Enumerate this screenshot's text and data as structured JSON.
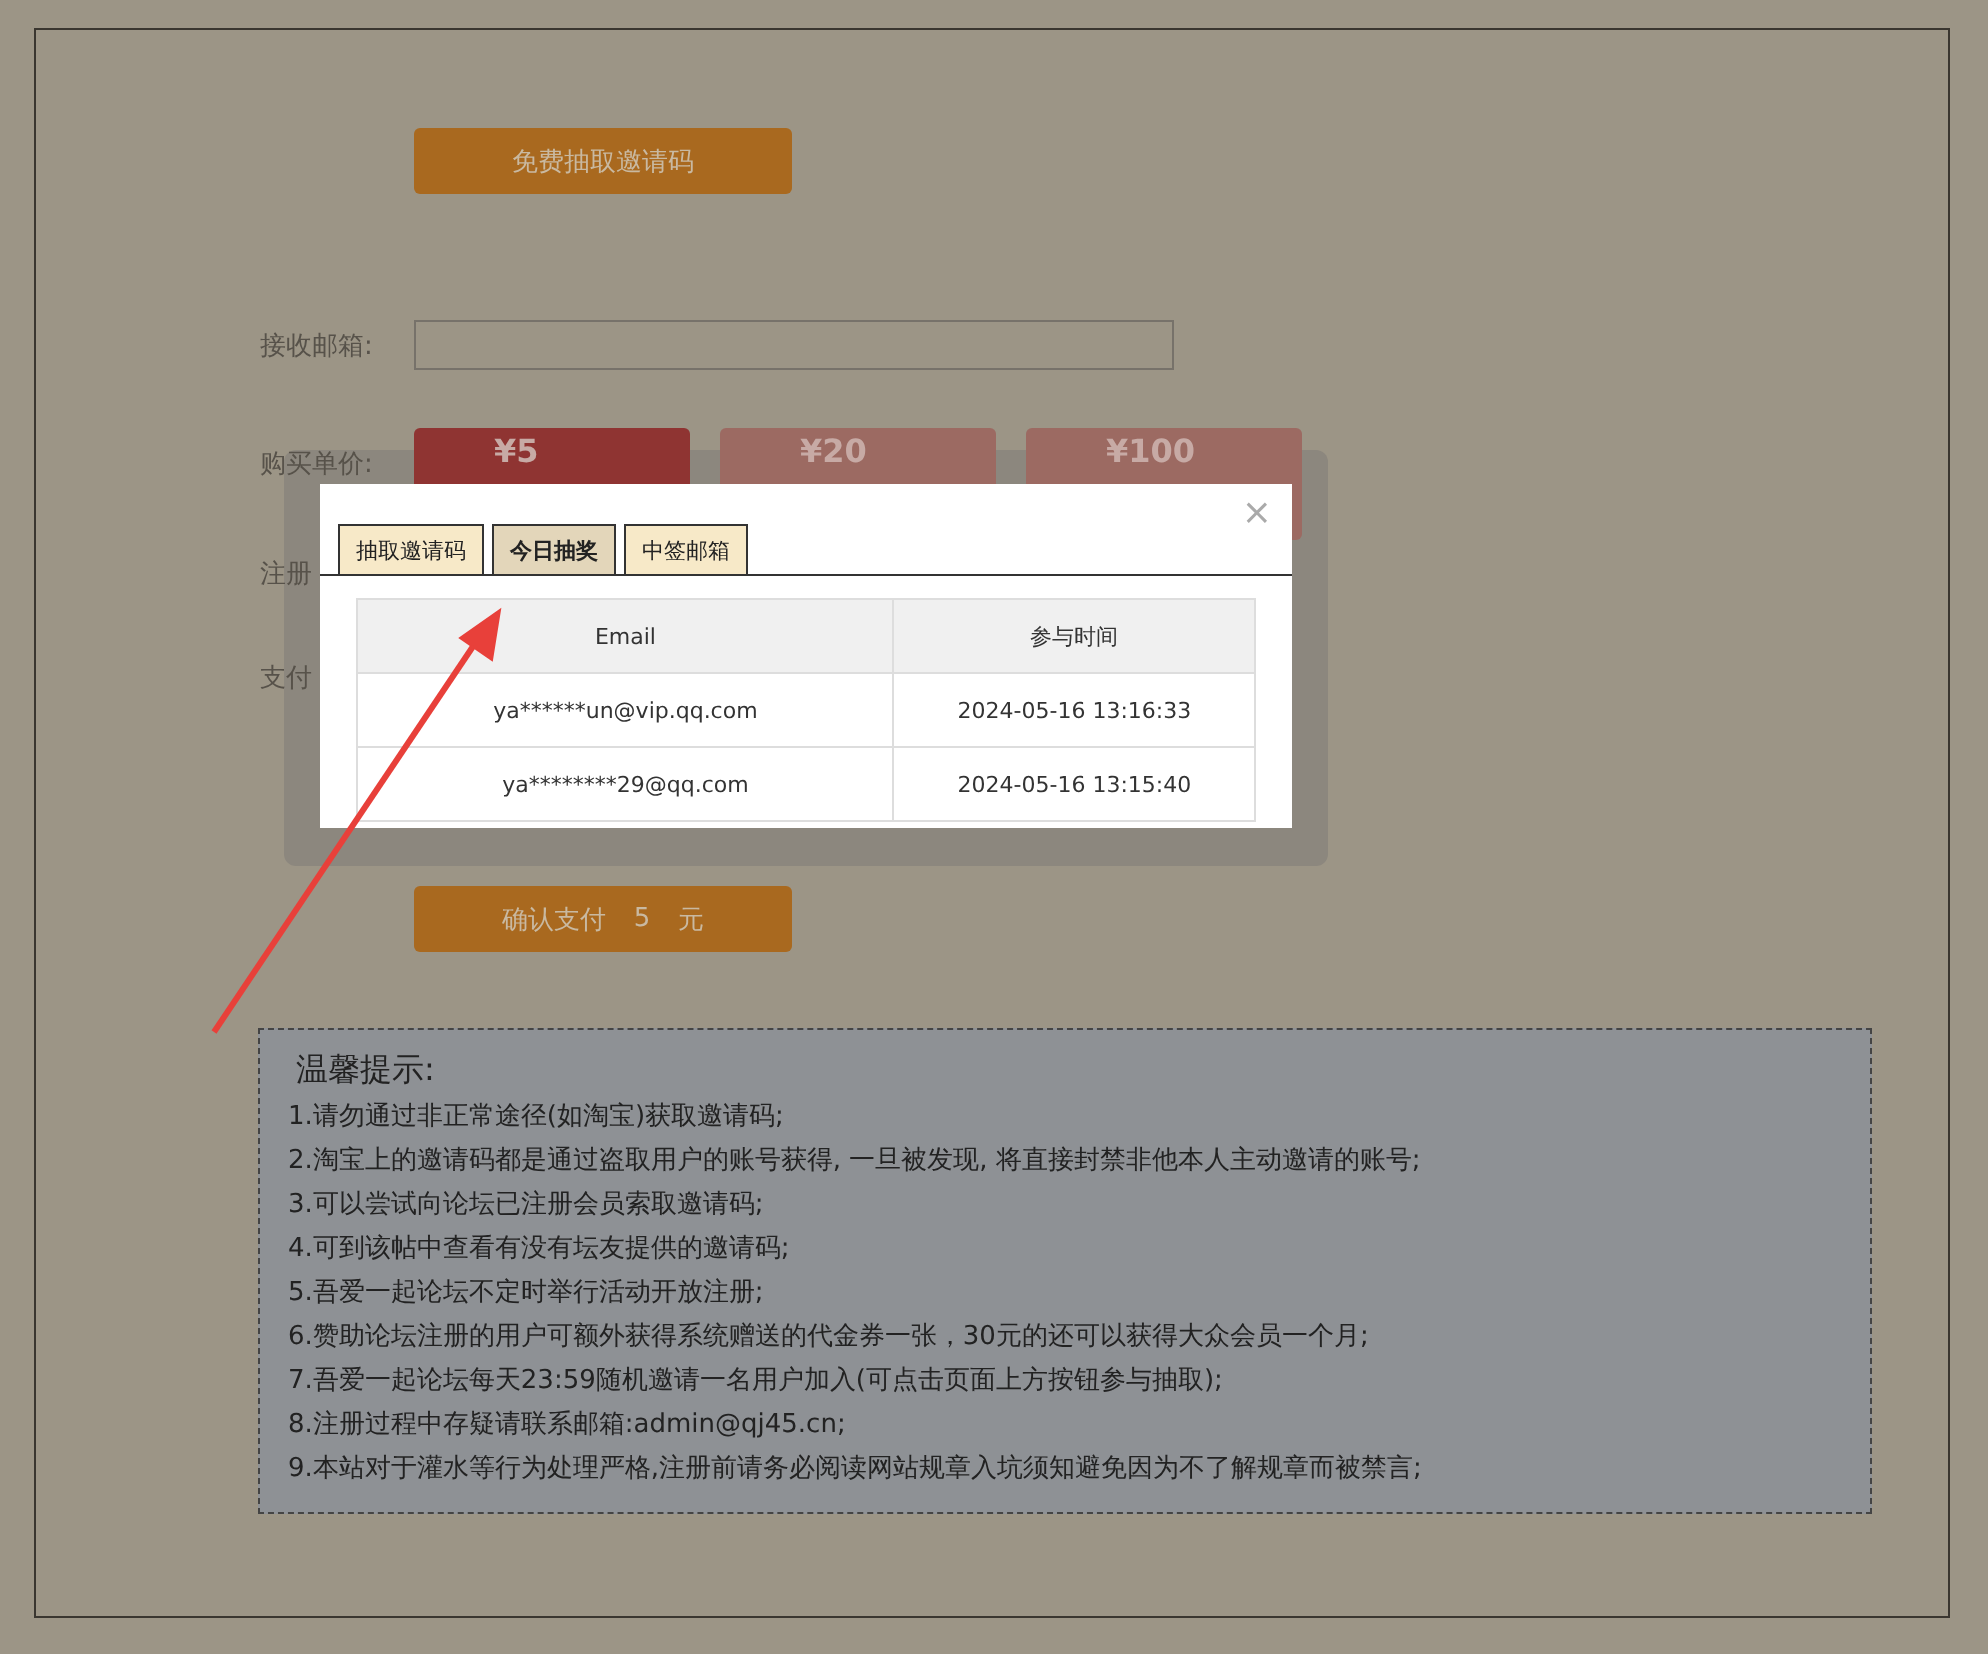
{
  "draw_button": {
    "label": "免费抽取邀请码"
  },
  "form": {
    "email": {
      "label": "接收邮箱:"
    },
    "price": {
      "label": "购买单价:",
      "options": [
        {
          "label": "¥5",
          "selected": true
        },
        {
          "label": "¥20",
          "selected": false
        },
        {
          "label": "¥100",
          "selected": false
        }
      ]
    },
    "row_3": {
      "label": "注册"
    },
    "row_4": {
      "label": "支付"
    }
  },
  "confirm_button": {
    "label": "确认支付",
    "amount": "5",
    "unit": "元"
  },
  "dialog": {
    "close": "×",
    "tabs": [
      {
        "label": "抽取邀请码",
        "selected": false
      },
      {
        "label": "今日抽奖",
        "selected": true
      },
      {
        "label": "中签邮箱",
        "selected": false
      }
    ],
    "table": {
      "columns": [
        "Email",
        "参与时间"
      ],
      "rows": [
        [
          "ya******un@vip.qq.com",
          "2024-05-16 13:16:33"
        ],
        [
          "ya********29@qq.com",
          "2024-05-16 13:15:40"
        ]
      ]
    }
  },
  "tips": {
    "title": "温馨提示:",
    "items": [
      "1.请勿通过非正常途径(如淘宝)获取邀请码;",
      "2.淘宝上的邀请码都是通过盗取用户的账号获得, 一旦被发现, 将直接封禁非他本人主动邀请的账号;",
      "3.可以尝试向论坛已注册会员索取邀请码;",
      "4.可到该帖中查看有没有坛友提供的邀请码;",
      "5.吾爱一起论坛不定时举行活动开放注册;",
      "6.赞助论坛注册的用户可额外获得系统赠送的代金券一张，30元的还可以获得大众会员一个月;",
      "7.吾爱一起论坛每天23:59随机邀请一名用户加入(可点击页面上方按钮参与抽取);",
      "8.注册过程中存疑请联系邮箱:admin@qj45.cn;",
      "9.本站对于灌水等行为处理严格,注册前请务必阅读网站规章入坑须知避免因为不了解规章而被禁言;"
    ]
  }
}
